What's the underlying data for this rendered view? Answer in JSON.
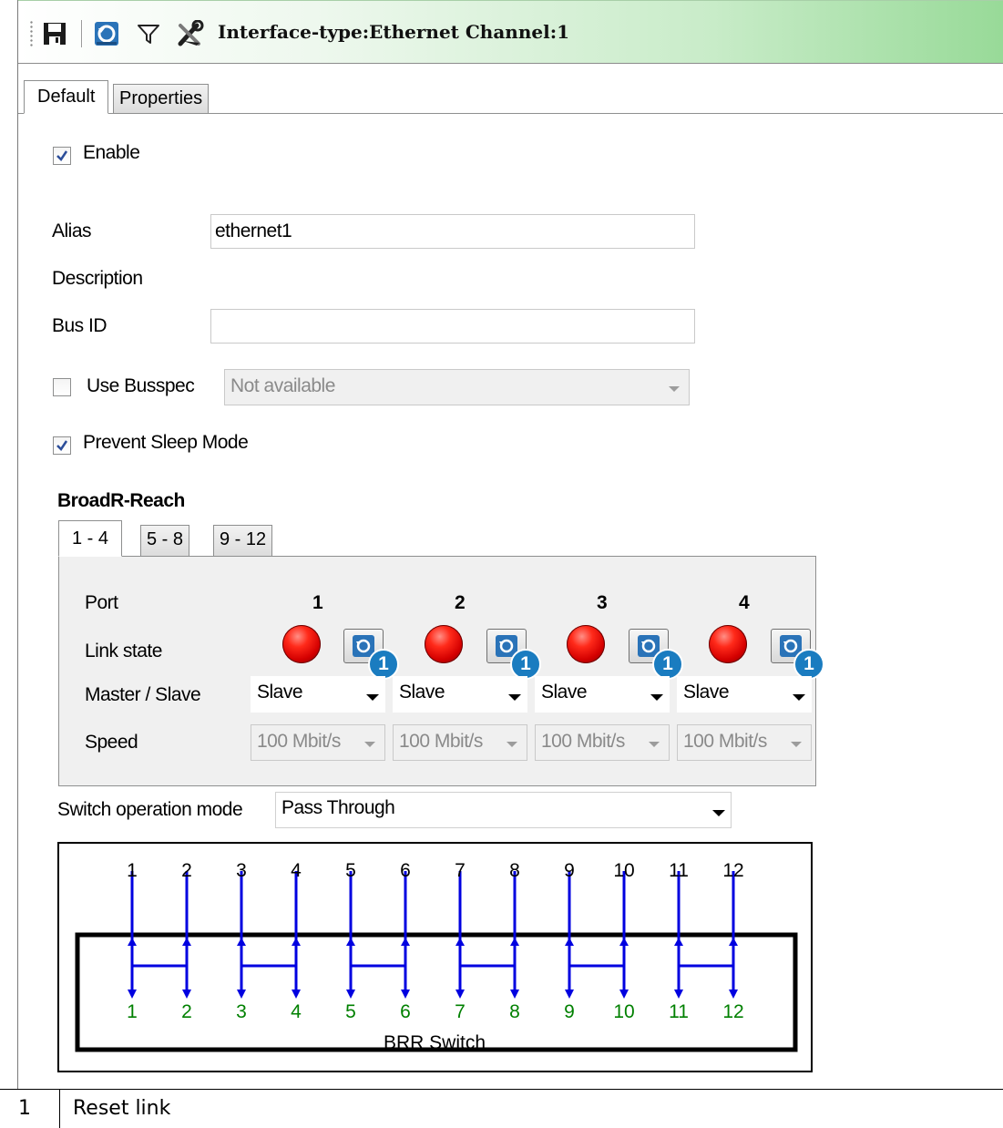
{
  "window": {
    "title": "Interface-type:Ethernet Channel:1"
  },
  "toolbar": {
    "icons": [
      "save-icon",
      "refresh-icon",
      "filter-icon",
      "tools-icon"
    ]
  },
  "tabs": [
    "Default",
    "Properties"
  ],
  "form": {
    "enable_label": "Enable",
    "enable_checked": true,
    "alias_label": "Alias",
    "alias_value": "ethernet1",
    "description_label": "Description",
    "busid_label": "Bus ID",
    "busid_value": "",
    "use_busspec_label": "Use Busspec",
    "use_busspec_checked": false,
    "busspec_value": "Not available",
    "prevent_sleep_label": "Prevent Sleep Mode",
    "prevent_sleep_checked": true
  },
  "broadr": {
    "title": "BroadR-Reach",
    "tabs": [
      "1 - 4",
      "5 - 8",
      "9 - 12"
    ],
    "port_label": "Port",
    "link_state_label": "Link state",
    "master_slave_label": "Master / Slave",
    "speed_label": "Speed",
    "ports": [
      {
        "num": "1",
        "mode": "Slave",
        "speed": "100 Mbit/s",
        "badge": "1"
      },
      {
        "num": "2",
        "mode": "Slave",
        "speed": "100 Mbit/s",
        "badge": "1"
      },
      {
        "num": "3",
        "mode": "Slave",
        "speed": "100 Mbit/s",
        "badge": "1"
      },
      {
        "num": "4",
        "mode": "Slave",
        "speed": "100 Mbit/s",
        "badge": "1"
      }
    ],
    "link_color": "#e00000",
    "badge_color": "#1a7cc0"
  },
  "switch": {
    "label": "Switch operation mode",
    "value": "Pass Through",
    "caption": "BRR Switch",
    "top_ports": [
      "1",
      "2",
      "3",
      "4",
      "5",
      "6",
      "7",
      "8",
      "9",
      "10",
      "11",
      "12"
    ],
    "bottom_ports": [
      "1",
      "2",
      "3",
      "4",
      "5",
      "6",
      "7",
      "8",
      "9",
      "10",
      "11",
      "12"
    ],
    "line_color": "#0000e0",
    "bottom_label_color": "#008000"
  },
  "legend": {
    "number": "1",
    "text": "Reset link"
  }
}
